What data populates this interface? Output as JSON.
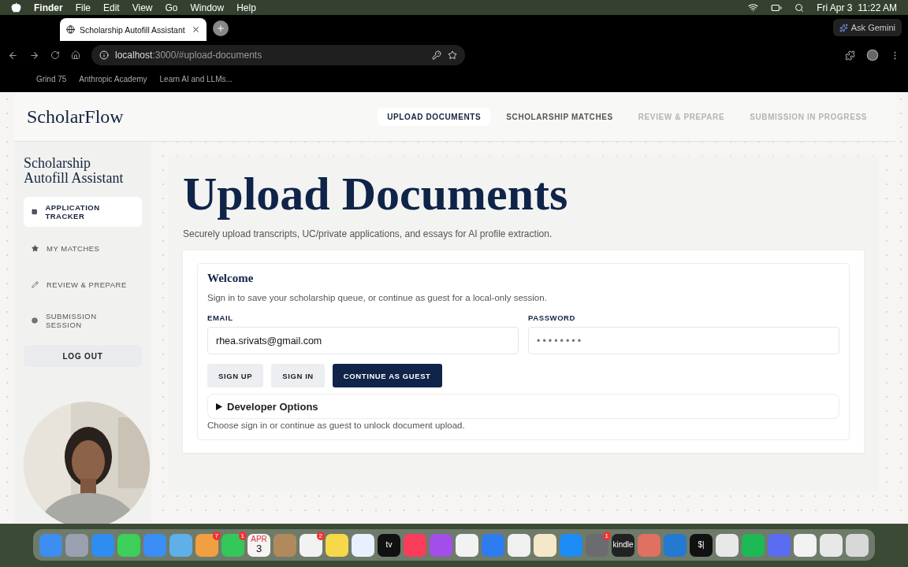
{
  "menu_bar": {
    "app": "Finder",
    "menus": [
      "File",
      "Edit",
      "View",
      "Go",
      "Window",
      "Help"
    ],
    "date": "Fri Apr 3",
    "time": "11:22 AM"
  },
  "browser": {
    "tab": {
      "title": "Scholarship Autofill Assistant",
      "selected": true
    },
    "ask_button": "Ask Gemini",
    "url_host": "localhost",
    "url_rest": ":3000/#upload-documents",
    "bookmarks": [
      "Grind 75",
      "Anthropic Academy",
      "Learn AI and LLMs..."
    ]
  },
  "page": {
    "logo": "ScholarFlow",
    "nav": [
      {
        "label": "UPLOAD DOCUMENTS",
        "selected": true,
        "disabled": false
      },
      {
        "label": "SCHOLARSHIP MATCHES",
        "selected": false,
        "disabled": false
      },
      {
        "label": "REVIEW & PREPARE",
        "selected": false,
        "disabled": true
      },
      {
        "label": "SUBMISSION IN PROGRESS",
        "selected": false,
        "disabled": true
      }
    ],
    "sidebar": {
      "title": "Scholarship Autofill Assistant",
      "items": [
        {
          "label": "APPLICATION TRACKER",
          "selected": true
        },
        {
          "label": "MY MATCHES",
          "selected": false
        },
        {
          "label": "REVIEW & PREPARE",
          "selected": false
        },
        {
          "label": "SUBMISSION SESSION",
          "selected": false
        }
      ],
      "logout": "LOG OUT"
    },
    "heading": "Upload Documents",
    "subtitle": "Securely upload transcripts, UC/private applications, and essays for AI profile extraction.",
    "welcome": {
      "title": "Welcome",
      "text": "Sign in to save your scholarship queue, or continue as guest for a local-only session.",
      "email_label": "EMAIL",
      "email": "rhea.srivats@gmail.com",
      "password_label": "PASSWORD",
      "password": "••••••••",
      "buttons": [
        {
          "label": "SIGN UP",
          "kind": "secondary"
        },
        {
          "label": "SIGN IN",
          "kind": "secondary"
        },
        {
          "label": "CONTINUE AS GUEST",
          "kind": "primary"
        }
      ],
      "developer_options": {
        "label": "Developer Options",
        "expanded": false
      },
      "note": "Choose sign in or continue as guest to unlock document upload."
    }
  },
  "dock": [
    {
      "color": "#3d8ef0"
    },
    {
      "color": "#9aa0b0"
    },
    {
      "color": "#2f8cf0"
    },
    {
      "color": "#3ccf5a"
    },
    {
      "color": "#3a8ef5"
    },
    {
      "color": "#5fb0e8"
    },
    {
      "color": "#f0a040",
      "badge": "7"
    },
    {
      "color": "#34c759",
      "badge": "1"
    },
    {
      "color": "#f4f4f4",
      "month": "APR",
      "day": "3"
    },
    {
      "color": "#b08a5a"
    },
    {
      "color": "#f2f2f2",
      "badge": "2"
    },
    {
      "color": "#f7d84a"
    },
    {
      "color": "#e8f0ff"
    },
    {
      "color": "#111111",
      "text": "tv"
    },
    {
      "color": "#f83c5a"
    },
    {
      "color": "#a24ee8"
    },
    {
      "color": "#f2f2f2"
    },
    {
      "color": "#2d7cf0"
    },
    {
      "color": "#f0f0f0"
    },
    {
      "color": "#f4e8c8"
    },
    {
      "color": "#1e8cf5"
    },
    {
      "color": "#6b6b70",
      "badge": "1"
    },
    {
      "color": "#222222",
      "text": "kindle"
    },
    {
      "color": "#e07060"
    },
    {
      "color": "#2479d0"
    },
    {
      "color": "#111111",
      "text": "$|"
    },
    {
      "color": "#e8e8e8"
    },
    {
      "color": "#1db954"
    },
    {
      "color": "#5a6cf0"
    },
    {
      "color": "#f2f2f2"
    },
    {
      "color": "#e8e8e8"
    },
    {
      "color": "#d8d8d8"
    }
  ]
}
